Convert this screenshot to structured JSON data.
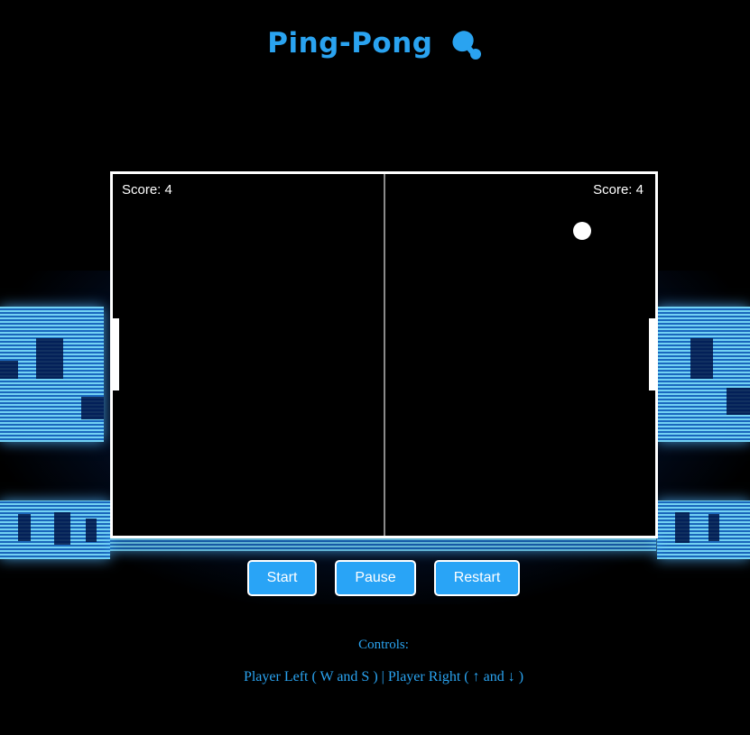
{
  "header": {
    "title": "Ping-Pong",
    "icon": "ping-pong-paddle-icon"
  },
  "game": {
    "score_left": "Score: 4",
    "score_right": "Score: 4"
  },
  "buttons": {
    "start": "Start",
    "pause": "Pause",
    "restart": "Restart"
  },
  "controls": {
    "title": "Controls:",
    "description": "Player Left ( W and S ) | Player Right ( ↑ and ↓ )"
  },
  "colors": {
    "accent": "#2aa3f0",
    "button_bg": "#29a4f6",
    "board_bg": "#000000",
    "board_border": "#ffffff"
  }
}
